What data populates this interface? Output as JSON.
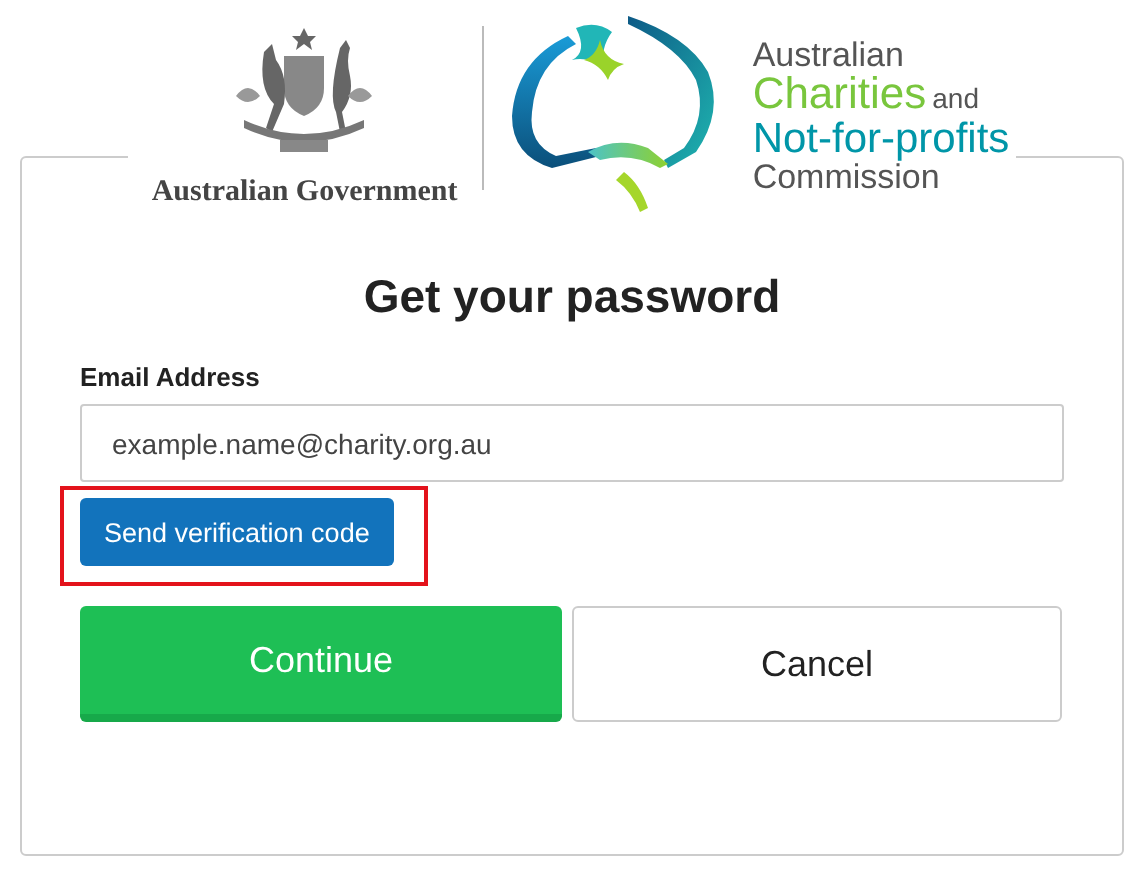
{
  "header": {
    "government_name": "Australian Government",
    "commission": {
      "line_1": "Australian",
      "line_2": "Charities",
      "line_2_suffix": "and",
      "line_3": "Not-for-profits",
      "line_4": "Commission"
    }
  },
  "form": {
    "title": "Get your password",
    "email": {
      "label": "Email Address",
      "value": "example.name@charity.org.au"
    },
    "send_button": {
      "label": "Send verification code",
      "highlighted": true
    },
    "continue_button": {
      "label": "Continue"
    },
    "cancel_button": {
      "label": "Cancel"
    }
  }
}
